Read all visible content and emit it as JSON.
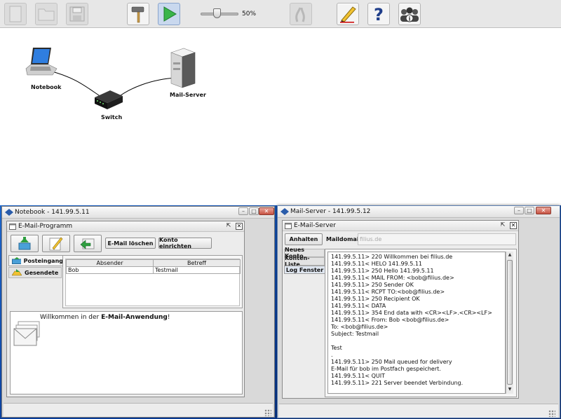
{
  "toolbar": {
    "zoom_label": "50%",
    "icons": [
      "new-file-icon",
      "open-folder-icon",
      "save-icon",
      "hammer-icon",
      "play-icon",
      "cable-icon",
      "pencil-icon",
      "help-icon",
      "info-icon"
    ]
  },
  "network": {
    "nodes": [
      {
        "id": "notebook",
        "label": "Notebook"
      },
      {
        "id": "switch",
        "label": "Switch"
      },
      {
        "id": "mailserver",
        "label": "Mail-Server"
      }
    ]
  },
  "notebook_window": {
    "title": "Notebook - 141.99.5.11",
    "app": {
      "title": "E-Mail-Programm",
      "delete_label": "E-Mail löschen",
      "setup_label": "Konto einrichten",
      "tabs": [
        {
          "label": "Posteingang",
          "selected": true
        },
        {
          "label": "Gesendete",
          "selected": false
        }
      ],
      "table": {
        "columns": [
          "Absender",
          "Betreff"
        ],
        "rows": [
          [
            "Bob",
            "Testmail"
          ]
        ]
      },
      "welcome_prefix": "Willkommen in der ",
      "welcome_bold": "E-Mail-Anwendung",
      "welcome_suffix": "!"
    }
  },
  "mailserver_window": {
    "title": "Mail-Server - 141.99.5.12",
    "app": {
      "title": "E-Mail-Server",
      "stop_label": "Anhalten",
      "domain_label": "Maildomain:",
      "domain_value": "filius.de",
      "tabs": [
        {
          "label": "Neues Konto",
          "selected": false
        },
        {
          "label": "Konten-Liste",
          "selected": false
        },
        {
          "label": "Log Fenster",
          "selected": true
        }
      ],
      "log_lines": [
        "141.99.5.11> 220 Willkommen bei filius.de",
        "141.99.5.11< HELO 141.99.5.11",
        "141.99.5.11> 250 Hello 141.99.5.11",
        "141.99.5.11< MAIL FROM: <bob@filius.de>",
        "141.99.5.11> 250 Sender OK",
        "141.99.5.11< RCPT TO:<bob@filius.de>",
        "141.99.5.11> 250 Recipient OK",
        "141.99.5.11< DATA",
        "141.99.5.11> 354 End data with <CR><LF>.<CR><LF>",
        "141.99.5.11< From: Bob <bob@filius.de>",
        "To: <bob@filius.de>",
        "Subject: Testmail",
        "",
        "Test",
        ".",
        "141.99.5.11> 250 Mail queued for delivery",
        "E-Mail für bob im Postfach gespeichert.",
        "141.99.5.11< QUIT",
        "141.99.5.11> 221 Server beendet Verbindung."
      ]
    }
  }
}
